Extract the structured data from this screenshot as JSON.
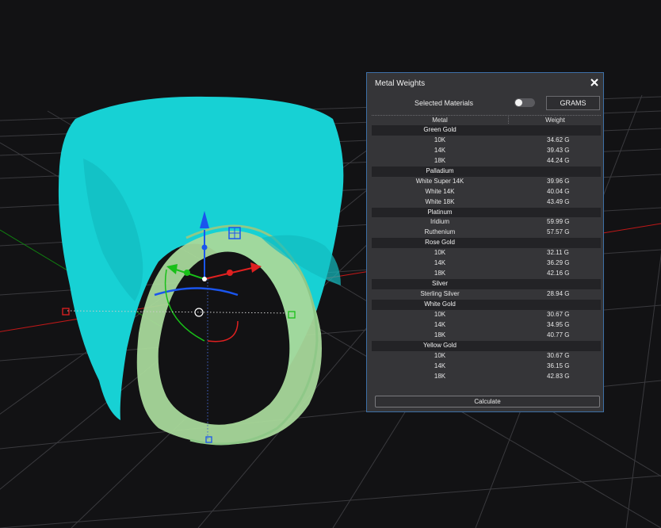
{
  "panel": {
    "title": "Metal Weights",
    "selected_materials_label": "Selected Materials",
    "toggle_on": false,
    "unit_button": "GRAMS",
    "columns": [
      "Metal",
      "Weight"
    ],
    "groups": [
      {
        "name": "Green Gold",
        "items": [
          {
            "metal": "10K",
            "weight": "34.62 G"
          },
          {
            "metal": "14K",
            "weight": "39.43 G"
          },
          {
            "metal": "18K",
            "weight": "44.24 G"
          }
        ]
      },
      {
        "name": "Palladium",
        "items": [
          {
            "metal": "White Super 14K",
            "weight": "39.96 G"
          },
          {
            "metal": "White 14K",
            "weight": "40.04 G"
          },
          {
            "metal": "White 18K",
            "weight": "43.49 G"
          }
        ]
      },
      {
        "name": "Platinum",
        "items": [
          {
            "metal": "Iridium",
            "weight": "59.99 G"
          },
          {
            "metal": "Ruthenium",
            "weight": "57.57 G"
          }
        ]
      },
      {
        "name": "Rose Gold",
        "items": [
          {
            "metal": "10K",
            "weight": "32.11 G"
          },
          {
            "metal": "14K",
            "weight": "36.29 G"
          },
          {
            "metal": "18K",
            "weight": "42.16 G"
          }
        ]
      },
      {
        "name": "Silver",
        "items": [
          {
            "metal": "Sterling Silver",
            "weight": "28.94 G"
          }
        ]
      },
      {
        "name": "White Gold",
        "items": [
          {
            "metal": "10K",
            "weight": "30.67 G"
          },
          {
            "metal": "14K",
            "weight": "34.95 G"
          },
          {
            "metal": "18K",
            "weight": "40.77 G"
          }
        ]
      },
      {
        "name": "Yellow Gold",
        "items": [
          {
            "metal": "10K",
            "weight": "30.67 G"
          },
          {
            "metal": "14K",
            "weight": "36.15 G"
          },
          {
            "metal": "18K",
            "weight": "42.83 G"
          }
        ]
      }
    ],
    "calculate_label": "Calculate"
  },
  "viewport": {
    "background": "#121214",
    "grid_color": "#3a3a3e",
    "model_color": "#17d1d4",
    "model_band_color": "#a8d89a",
    "axis_x_color": "#e02020",
    "axis_y_color": "#18c018",
    "axis_z_color": "#1a55ee"
  }
}
